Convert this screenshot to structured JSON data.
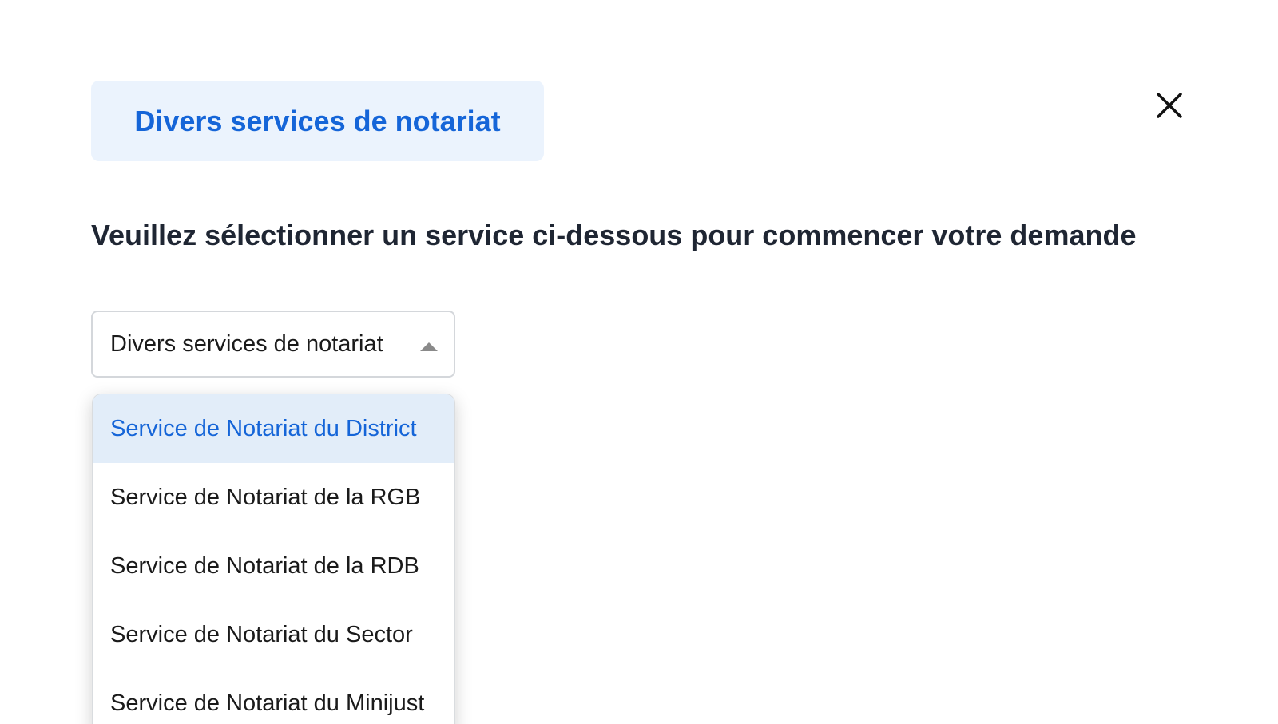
{
  "modal": {
    "title": "Divers services de notariat",
    "close_icon": "close-icon"
  },
  "prompt": {
    "text": "Veuillez sélectionner un service ci-dessous pour commencer votre demande"
  },
  "select": {
    "selected_value": "Divers services de notariat",
    "caret_icon": "caret-up-icon",
    "options": [
      {
        "label": "Service de Notariat du District",
        "highlighted": true
      },
      {
        "label": "Service de Notariat de la RGB",
        "highlighted": false
      },
      {
        "label": "Service de Notariat de la RDB",
        "highlighted": false
      },
      {
        "label": "Service de Notariat du Sector",
        "highlighted": false
      },
      {
        "label": "Service de Notariat du Minijust",
        "highlighted": false
      }
    ]
  },
  "colors": {
    "accent": "#1565d8",
    "chip_bg": "#ebf3fd",
    "highlight_bg": "#e2edf9",
    "heading": "#1f2633"
  }
}
